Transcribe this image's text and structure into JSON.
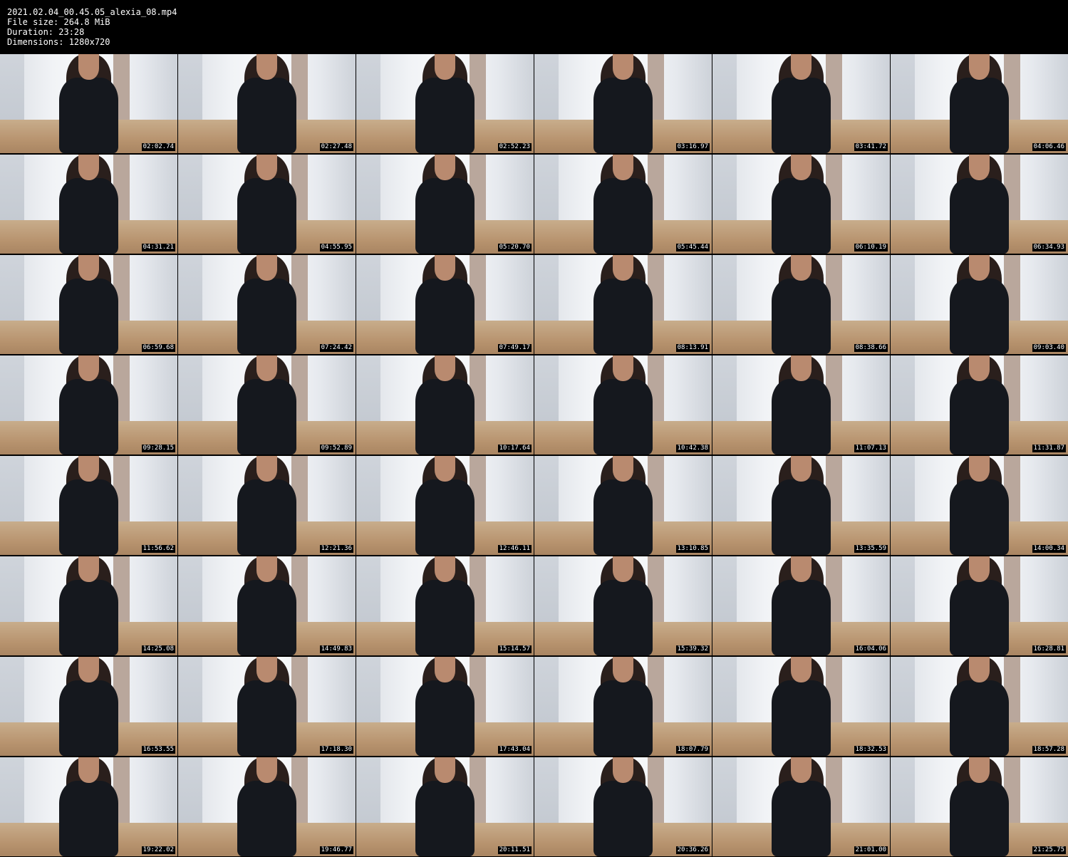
{
  "header": {
    "filename": "2021.02.04_00.45.05_alexia_08.mp4",
    "file_size": "File size: 264.8 MiB",
    "duration": "Duration: 23:28",
    "dimensions": "Dimensions: 1280x720"
  },
  "thumbnails": [
    "02:02.74",
    "02:27.48",
    "02:52.23",
    "03:16.97",
    "03:41.72",
    "04:06.46",
    "04:31.21",
    "04:55.95",
    "05:20.70",
    "05:45.44",
    "06:10.19",
    "06:34.93",
    "06:59.68",
    "07:24.42",
    "07:49.17",
    "08:13.91",
    "08:38.66",
    "09:03.40",
    "09:28.15",
    "09:52.89",
    "10:17.64",
    "10:42.38",
    "11:07.13",
    "11:31.87",
    "11:56.62",
    "12:21.36",
    "12:46.11",
    "13:10.85",
    "13:35.59",
    "14:00.34",
    "14:25.08",
    "14:49.83",
    "15:14.57",
    "15:39.32",
    "16:04.06",
    "16:28.81",
    "16:53.55",
    "17:18.30",
    "17:43.04",
    "18:07.79",
    "18:32.53",
    "18:57.28",
    "19:22.02",
    "19:46.77",
    "20:11.51",
    "20:36.26",
    "21:01.00",
    "21:25.75"
  ]
}
